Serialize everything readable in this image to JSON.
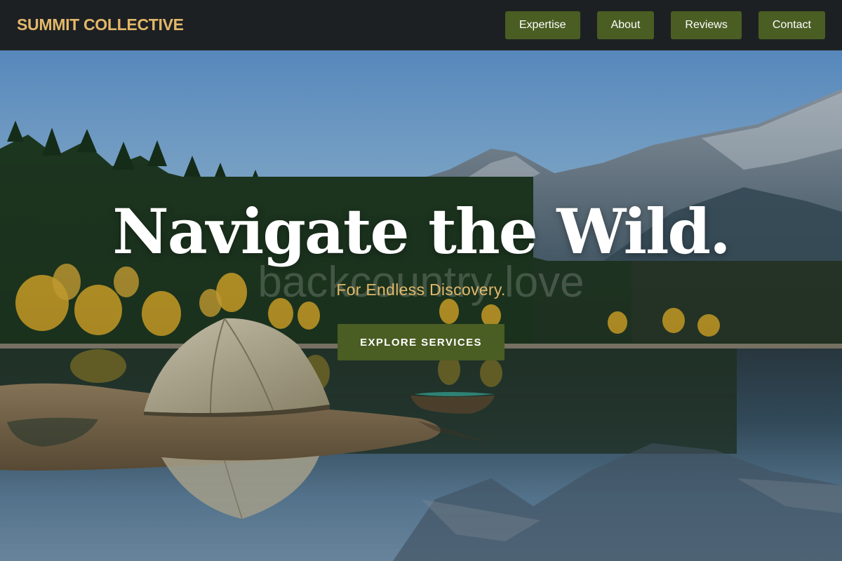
{
  "header": {
    "brand": "SUMMIT COLLECTIVE",
    "nav": [
      "Expertise",
      "About",
      "Reviews",
      "Contact"
    ]
  },
  "hero": {
    "headline": "Navigate the Wild.",
    "watermark": "backcountry love",
    "tagline": "For Endless Discovery.",
    "cta_label": "EXPLORE SERVICES"
  },
  "colors": {
    "brand_gold": "#e2b86a",
    "accent_green": "#4a5d23",
    "header_bg": "#1d2023"
  }
}
